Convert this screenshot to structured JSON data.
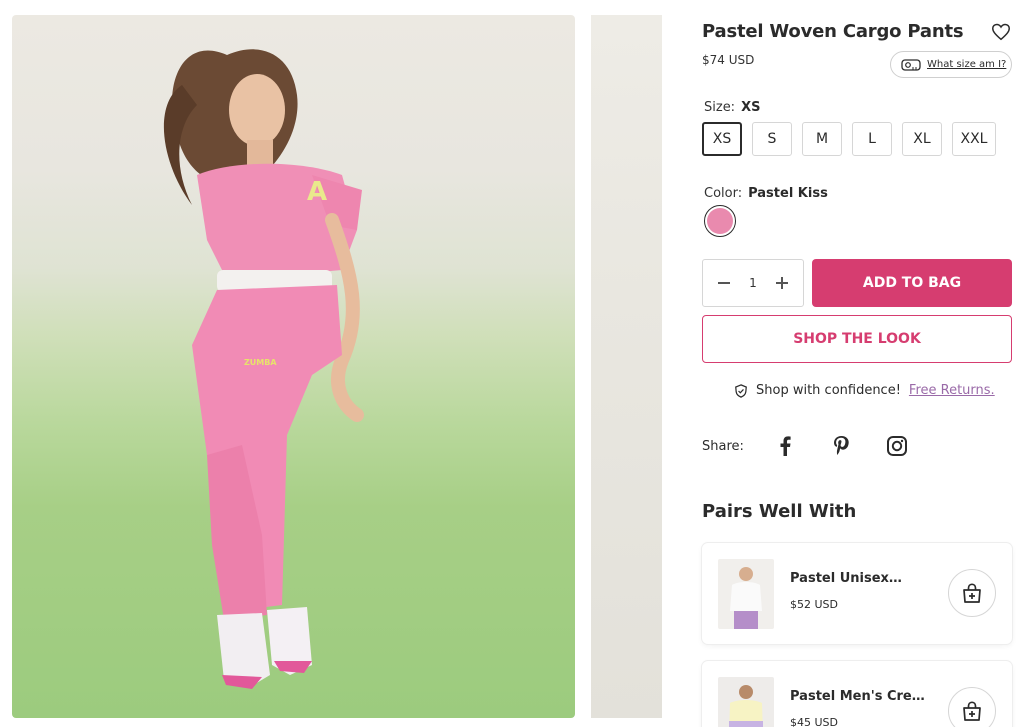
{
  "product": {
    "title": "Pastel Woven Cargo Pants",
    "price": "$74 USD",
    "size_guide_label": "What size am I?",
    "size_label": "Size:",
    "selected_size": "XS",
    "sizes": [
      "XS",
      "S",
      "M",
      "L",
      "XL",
      "XXL"
    ],
    "color_label": "Color:",
    "selected_color": "Pastel Kiss",
    "swatch_color": "#e98aae",
    "quantity": "1"
  },
  "actions": {
    "add_to_bag": "ADD TO BAG",
    "shop_the_look": "SHOP THE LOOK"
  },
  "confidence": {
    "text": "Shop with confidence!",
    "link": "Free Returns."
  },
  "share": {
    "label": "Share:",
    "icons": [
      "facebook-icon",
      "pinterest-icon",
      "instagram-icon"
    ]
  },
  "pairs": {
    "heading": "Pairs Well With",
    "items": [
      {
        "name": "Pastel Unisex…",
        "price": "$52 USD"
      },
      {
        "name": "Pastel Men's Crew…",
        "price": "$45 USD"
      }
    ]
  },
  "colors": {
    "accent": "#d63d70",
    "link": "#9a6aa8"
  }
}
